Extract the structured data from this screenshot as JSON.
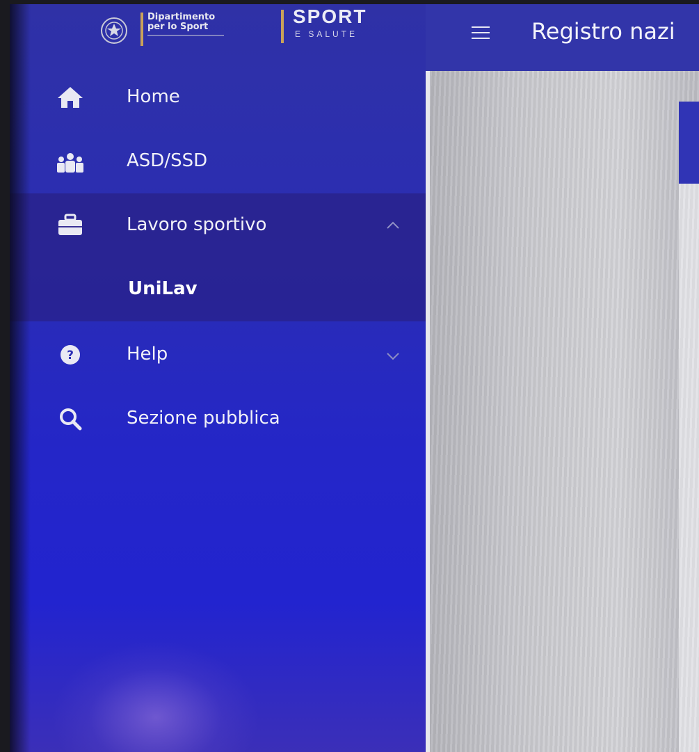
{
  "brand": {
    "department_line1": "Dipartimento",
    "department_line2": "per lo Sport",
    "sport_title": "SPORT",
    "sport_subtitle": "E SALUTE"
  },
  "header": {
    "title": "Registro nazi"
  },
  "sidebar": {
    "items": [
      {
        "label": "Home",
        "icon": "home-icon"
      },
      {
        "label": "ASD/SSD",
        "icon": "people-icon"
      },
      {
        "label": "Lavoro sportivo",
        "icon": "briefcase-icon",
        "expanded": true,
        "children": [
          {
            "label": "UniLav"
          }
        ]
      },
      {
        "label": "Help",
        "icon": "help-icon",
        "expanded": false
      },
      {
        "label": "Sezione pubblica",
        "icon": "search-icon"
      }
    ]
  },
  "colors": {
    "sidebar": "#2a2db4",
    "header": "#3235a9",
    "accent_gold": "#c9a25a",
    "card_header": "#3034b5"
  }
}
